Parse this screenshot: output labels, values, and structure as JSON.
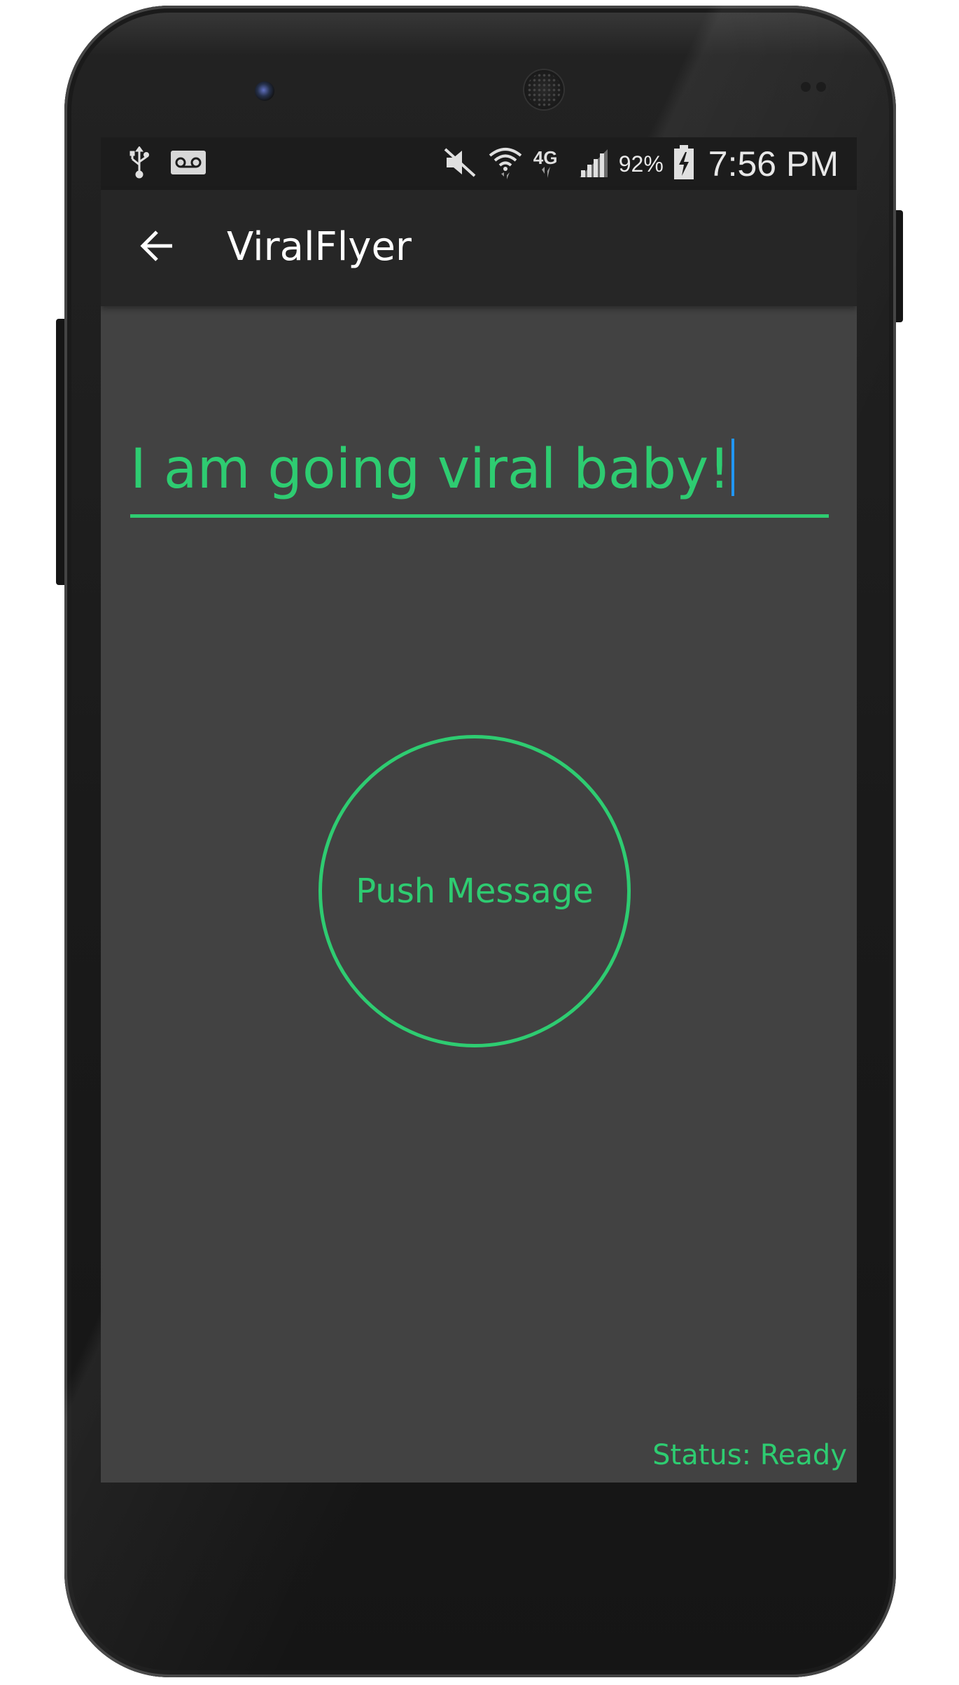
{
  "statusbar": {
    "left_icons": [
      "usb-icon",
      "voicemail-icon"
    ],
    "right_icons": [
      "vibrate-mute-icon",
      "wifi-icon",
      "lte-4g-icon",
      "signal-icon"
    ],
    "battery_percent": "92%",
    "battery_icon": "battery-charging-icon",
    "clock": "7:56 PM",
    "network_label": "4G"
  },
  "toolbar": {
    "back_icon": "arrow-back-icon",
    "title": "ViralFlyer"
  },
  "main": {
    "message_value": "I am going viral baby!",
    "push_button_label": "Push Message",
    "status_text": "Status: Ready"
  },
  "colors": {
    "accent": "#2ecc71",
    "screen_bg": "#424242",
    "toolbar_bg": "#262626",
    "statusbar_bg": "#1c1c1c",
    "caret": "#2196f3"
  }
}
